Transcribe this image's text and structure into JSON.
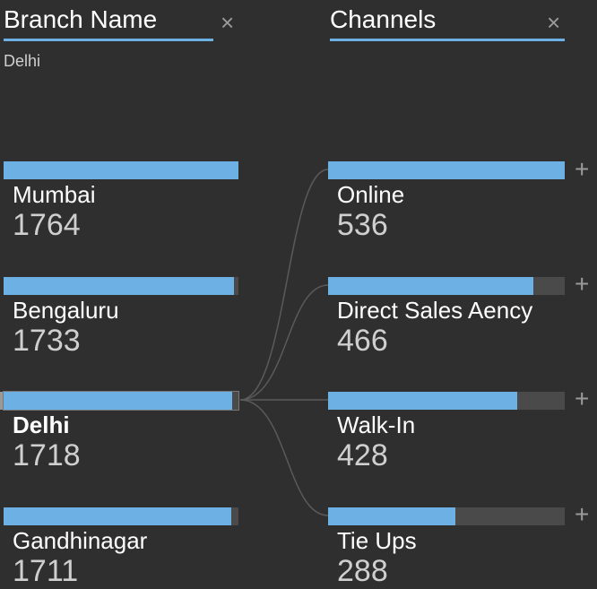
{
  "branch_column": {
    "title": "Branch Name",
    "close_icon": "close-icon",
    "filter_value": "Delhi",
    "items": [
      {
        "label": "Mumbai",
        "value": "1764",
        "fill": 1.0
      },
      {
        "label": "Bengaluru",
        "value": "1733",
        "fill": 0.982
      },
      {
        "label": "Delhi",
        "value": "1718",
        "fill": 0.974,
        "selected": true
      },
      {
        "label": "Gandhinagar",
        "value": "1711",
        "fill": 0.97
      }
    ]
  },
  "channels_column": {
    "title": "Channels",
    "close_icon": "close-icon",
    "expand_icon": "plus-icon",
    "items": [
      {
        "label": "Online",
        "value": "536",
        "fill": 1.0
      },
      {
        "label": "Direct Sales Aency",
        "value": "466",
        "fill": 0.869
      },
      {
        "label": "Walk-In",
        "value": "428",
        "fill": 0.799
      },
      {
        "label": "Tie Ups",
        "value": "288",
        "fill": 0.537
      }
    ]
  },
  "colors": {
    "accent": "#6cb0e4",
    "background": "#2f2f2f",
    "track": "#4a4a4a",
    "link": "#5a5a5a"
  }
}
